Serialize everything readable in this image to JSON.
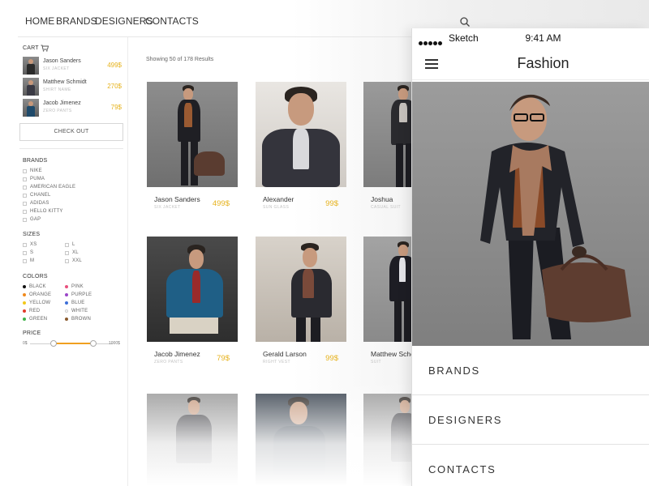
{
  "topnav": {
    "items": [
      "HOME",
      "BRANDS",
      "DESIGNERS",
      "CONTACTS"
    ],
    "search_icon": "search-icon"
  },
  "sidebar": {
    "cart": {
      "title": "CART",
      "items": [
        {
          "name": "Jason Sanders",
          "sub": "SIX JACKET",
          "price": "499$"
        },
        {
          "name": "Matthew Schmidt",
          "sub": "SHIRT NAME",
          "price": "270$"
        },
        {
          "name": "Jacob Jimenez",
          "sub": "ZERO PANTS",
          "price": "79$"
        }
      ],
      "checkout_label": "CHECK OUT"
    },
    "brands": {
      "title": "BRANDS",
      "items": [
        "NIKE",
        "PUMA",
        "AMERICAN EAGLE",
        "CHANEL",
        "ADIDAS",
        "HELLO KITTY",
        "GAP"
      ]
    },
    "sizes": {
      "title": "SIZES",
      "col1": [
        "XS",
        "S",
        "M"
      ],
      "col2": [
        "L",
        "XL",
        "XXL"
      ]
    },
    "colors": {
      "title": "COLORS",
      "col1": [
        {
          "label": "BLACK",
          "color": "#111111"
        },
        {
          "label": "ORANGE",
          "color": "#f08a1c"
        },
        {
          "label": "YELLOW",
          "color": "#f2c81a"
        },
        {
          "label": "RED",
          "color": "#e23a2a"
        },
        {
          "label": "GREEN",
          "color": "#3fb34a"
        }
      ],
      "col2": [
        {
          "label": "PINK",
          "color": "#e9507d"
        },
        {
          "label": "PURPLE",
          "color": "#9b46c8"
        },
        {
          "label": "BLUE",
          "color": "#3d6fd8"
        },
        {
          "label": "WHITE",
          "color": "#ffffff"
        },
        {
          "label": "BROWN",
          "color": "#8a5a2e"
        }
      ]
    },
    "price": {
      "title": "PRICE",
      "min": "0$",
      "max": "1000$"
    }
  },
  "main": {
    "results_text": "Showing 50 of 178 Results",
    "products": [
      {
        "name": "Jason Sanders",
        "sub": "SIX JACKET",
        "price": "499$"
      },
      {
        "name": "Alexander",
        "sub": "SUN GLASS",
        "price": "99$"
      },
      {
        "name": "Joshua",
        "sub": "CASUAL SUIT",
        "price": ""
      },
      {
        "name": "Jacob Jimenez",
        "sub": "ZERO PANTS",
        "price": "79$"
      },
      {
        "name": "Gerald Larson",
        "sub": "RIGHT VEST",
        "price": "99$"
      },
      {
        "name": "Matthew Sche",
        "sub": "SUIT",
        "price": ""
      }
    ]
  },
  "phone": {
    "carrier": "Sketch",
    "time": "9:41 AM",
    "title": "Fashion",
    "menu": [
      "BRANDS",
      "DESIGNERS",
      "CONTACTS"
    ]
  },
  "colors": {
    "accent": "#e6b21c",
    "slider": "#f0a020"
  }
}
